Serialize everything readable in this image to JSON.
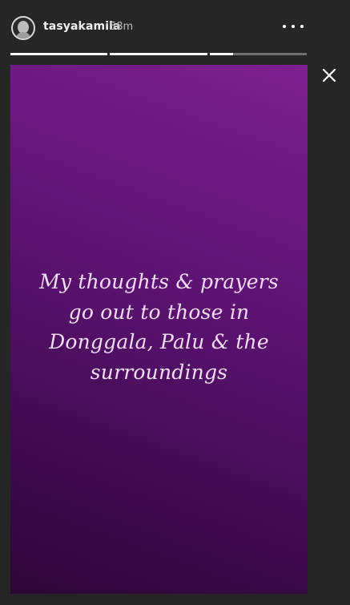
{
  "header": {
    "username": "tasyakamila",
    "time": "58m",
    "more_icon": "more-horizontal-icon",
    "avatar_icon": "profile-avatar"
  },
  "progress": {
    "segments": [
      1,
      1,
      0.24
    ]
  },
  "close_icon": "close-icon",
  "story": {
    "text": "My thoughts & prayers go out to those in Donggala, Palu & the surroundings",
    "gradient_colors": [
      "#7d1f91",
      "#5a1270",
      "#3b0a4b",
      "#2c0736"
    ]
  }
}
